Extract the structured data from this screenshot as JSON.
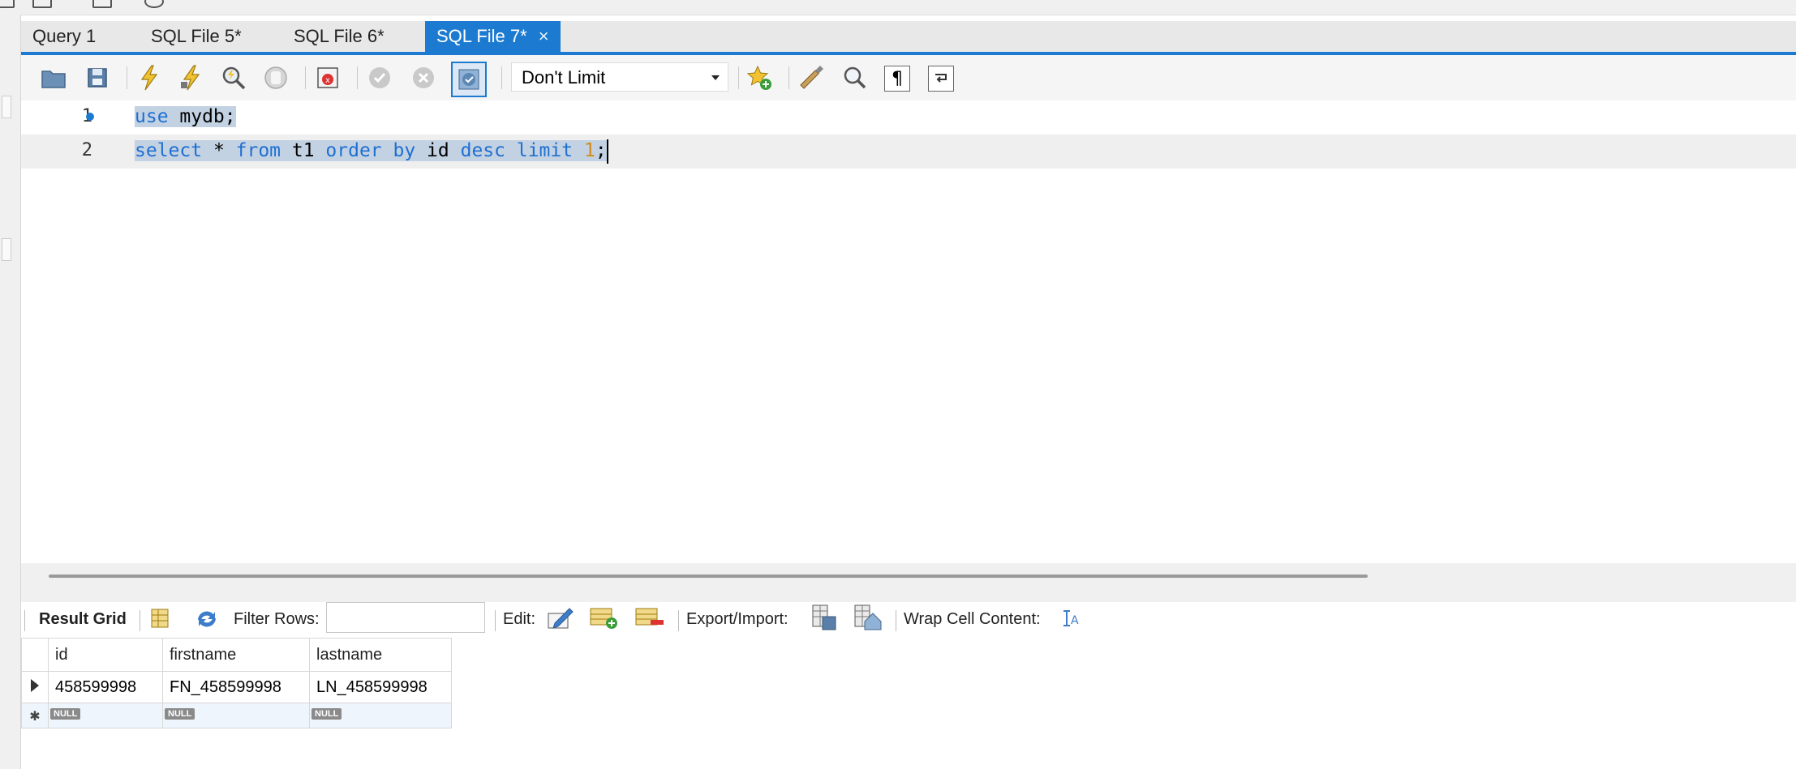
{
  "tabs": [
    {
      "label": "Query 1",
      "active": false
    },
    {
      "label": "SQL File 5*",
      "active": false
    },
    {
      "label": "SQL File 6*",
      "active": false
    },
    {
      "label": "SQL File 7*",
      "active": true
    }
  ],
  "tab_close_glyph": "×",
  "toolbar": {
    "icons": [
      "open-folder-icon",
      "save-icon",
      "execute-icon",
      "execute-current-icon",
      "explain-icon",
      "stop-icon",
      "toggle-error-icon",
      "commit-icon",
      "rollback-icon",
      "autocommit-icon"
    ],
    "limit_value": "Don't Limit",
    "right_icons": [
      "add-snippet-icon",
      "beautify-icon",
      "find-icon",
      "invisible-chars-icon",
      "word-wrap-icon"
    ]
  },
  "editor": {
    "lines": [
      {
        "num": "1",
        "tokens": [
          {
            "t": "use",
            "c": "kw"
          },
          {
            "t": " mydb;",
            "c": ""
          }
        ]
      },
      {
        "num": "2",
        "tokens": [
          {
            "t": "select",
            "c": "kw"
          },
          {
            "t": " * ",
            "c": ""
          },
          {
            "t": "from",
            "c": "kw"
          },
          {
            "t": " t1 ",
            "c": ""
          },
          {
            "t": "order by",
            "c": "kw"
          },
          {
            "t": " id ",
            "c": ""
          },
          {
            "t": "desc",
            "c": "kw"
          },
          {
            "t": " ",
            "c": ""
          },
          {
            "t": "limit",
            "c": "kw"
          },
          {
            "t": " ",
            "c": ""
          },
          {
            "t": "1",
            "c": "num"
          },
          {
            "t": ";",
            "c": ""
          }
        ]
      }
    ]
  },
  "result_toolbar": {
    "result_grid": "Result Grid",
    "filter_rows": "Filter Rows:",
    "edit": "Edit:",
    "export_import": "Export/Import:",
    "wrap_cell": "Wrap Cell Content:"
  },
  "grid": {
    "columns": [
      "id",
      "firstname",
      "lastname"
    ],
    "rows": [
      [
        "458599998",
        "FN_458599998",
        "LN_458599998"
      ]
    ],
    "null_label": "NULL",
    "new_row_marker": "✱"
  },
  "colors": {
    "accent": "#1c7bd1",
    "keyword": "#1f6fd1",
    "selection": "#c3d2e3"
  }
}
